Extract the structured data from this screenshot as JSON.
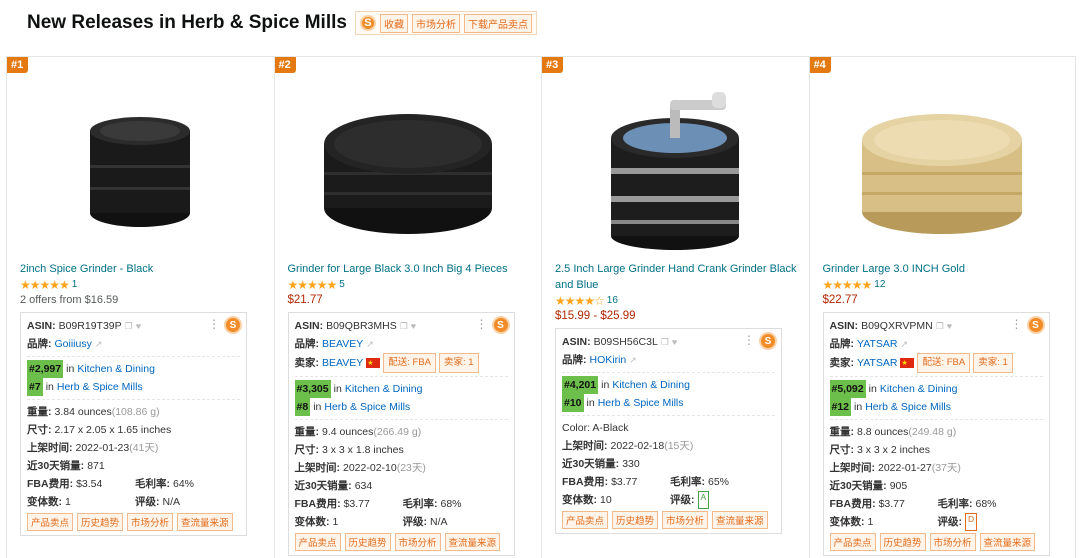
{
  "header": {
    "title": "New Releases in Herb & Spice Mills",
    "logo_char": "S",
    "buttons": [
      "收藏",
      "市场分析",
      "下载产品卖点"
    ]
  },
  "products": [
    {
      "rank": "#1",
      "title": "2inch Spice Grinder - Black",
      "stars": "★★★★★",
      "rating_count": "1",
      "price": "",
      "offers": "2 offers from $16.59",
      "asin": "B09R19T39P",
      "brand": "Goiiiusy",
      "seller": null,
      "variant": null,
      "rank_main": "#2,997",
      "rank_main_cat": "Kitchen & Dining",
      "rank_sub": "#7",
      "rank_sub_cat": "Herb & Spice Mills",
      "weight": "3.84 ounces",
      "weight_g": "(108.86 g)",
      "size": "2.17 x 2.05 x 1.65 inches",
      "date": "2022-01-23",
      "date_days": "(41天)",
      "sales30": "871",
      "fba": "$3.54",
      "margin": "64%",
      "variants": "1",
      "grade": "N/A",
      "grade_type": "text",
      "image": "grinder-black-small"
    },
    {
      "rank": "#2",
      "title": "Grinder for Large Black 3.0 Inch Big 4 Pieces",
      "stars": "★★★★★",
      "rating_count": "5",
      "price": "$21.77",
      "offers": "",
      "asin": "B09QBR3MHS",
      "brand": "BEAVEY",
      "seller": "BEAVEY",
      "seller_fba": "配送: FBA",
      "seller_count": "卖家: 1",
      "variant": null,
      "rank_main": "#3,305",
      "rank_main_cat": "Kitchen & Dining",
      "rank_sub": "#8",
      "rank_sub_cat": "Herb & Spice Mills",
      "weight": "9.4 ounces",
      "weight_g": "(266.49 g)",
      "size": "3 x 3 x 1.8 inches",
      "date": "2022-02-10",
      "date_days": "(23天)",
      "sales30": "634",
      "fba": "$3.77",
      "margin": "68%",
      "variants": "1",
      "grade": "N/A",
      "grade_type": "text",
      "image": "grinder-black-large"
    },
    {
      "rank": "#3",
      "title": "2.5 Inch Large Grinder Hand Crank Grinder Black and Blue",
      "stars": "★★★★☆",
      "rating_count": "16",
      "price": "$15.99 - $25.99",
      "offers": "",
      "asin": "B09SH56C3L",
      "brand": "HOKirin",
      "seller": null,
      "variant": "Color: A-Black",
      "rank_main": "#4,201",
      "rank_main_cat": "Kitchen & Dining",
      "rank_sub": "#10",
      "rank_sub_cat": "Herb & Spice Mills",
      "weight": "",
      "weight_g": "",
      "size": "",
      "date": "2022-02-18",
      "date_days": "(15天)",
      "sales30": "330",
      "fba": "$3.77",
      "margin": "65%",
      "variants": "10",
      "grade": "A",
      "grade_type": "a",
      "image": "grinder-crank"
    },
    {
      "rank": "#4",
      "title": "Grinder Large 3.0 INCH Gold",
      "stars": "★★★★★",
      "rating_count": "12",
      "price": "$22.77",
      "offers": "",
      "asin": "B09QXRVPMN",
      "brand": "YATSAR",
      "seller": "YATSAR",
      "seller_fba": "配送: FBA",
      "seller_count": "卖家: 1",
      "variant": null,
      "rank_main": "#5,092",
      "rank_main_cat": "Kitchen & Dining",
      "rank_sub": "#12",
      "rank_sub_cat": "Herb & Spice Mills",
      "weight": "8.8 ounces",
      "weight_g": "(249.48 g)",
      "size": "3 x 3 x 2 inches",
      "date": "2022-01-27",
      "date_days": "(37天)",
      "sales30": "905",
      "fba": "$3.77",
      "margin": "68%",
      "variants": "1",
      "grade": "D",
      "grade_type": "d",
      "image": "grinder-gold"
    }
  ],
  "labels": {
    "asin": "ASIN:",
    "brand": "品牌:",
    "seller": "卖家:",
    "in": "in",
    "weight": "重量:",
    "size": "尺寸:",
    "date": "上架时间:",
    "sales30": "近30天销量:",
    "fba": "FBA费用:",
    "margin": "毛利率:",
    "variants": "变体数:",
    "grade": "评级:"
  },
  "card_tags": [
    "产品卖点",
    "历史趋势",
    "市场分析",
    "查流量来源"
  ],
  "colors": {
    "accent": "#e47911",
    "link": "#007185",
    "price": "#b12704",
    "rank_green": "#6dbf4b"
  }
}
